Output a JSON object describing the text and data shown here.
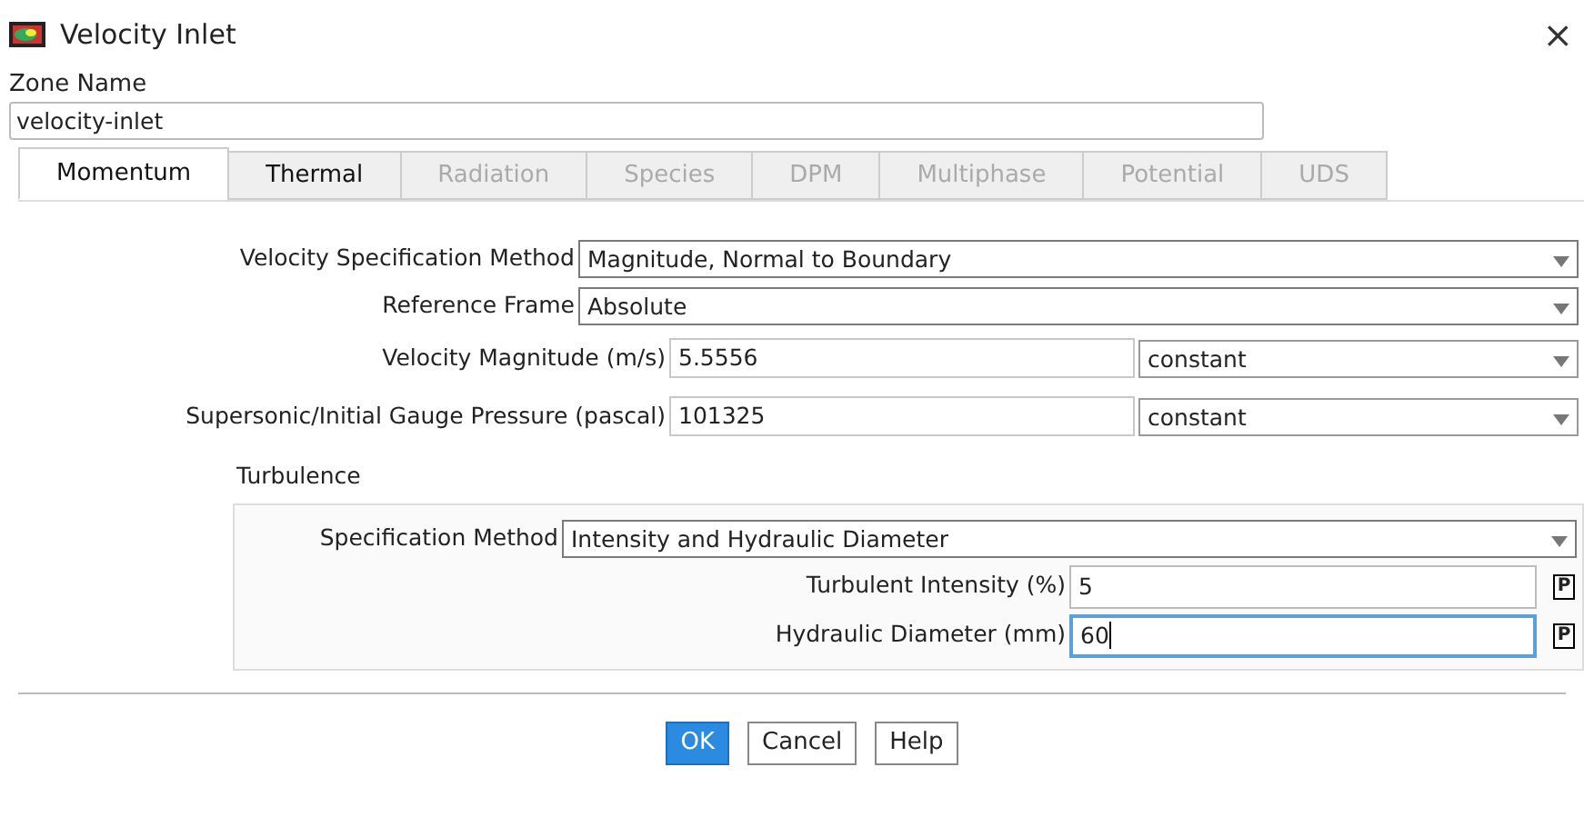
{
  "window": {
    "title": "Velocity Inlet",
    "close": "×"
  },
  "zone": {
    "label": "Zone Name",
    "value": "velocity-inlet"
  },
  "tabs": [
    {
      "label": "Momentum",
      "selected": true,
      "disabled": false
    },
    {
      "label": "Thermal",
      "selected": false,
      "disabled": false
    },
    {
      "label": "Radiation",
      "selected": false,
      "disabled": true
    },
    {
      "label": "Species",
      "selected": false,
      "disabled": true
    },
    {
      "label": "DPM",
      "selected": false,
      "disabled": true
    },
    {
      "label": "Multiphase",
      "selected": false,
      "disabled": true
    },
    {
      "label": "Potential",
      "selected": false,
      "disabled": true
    },
    {
      "label": "UDS",
      "selected": false,
      "disabled": true
    }
  ],
  "fields": [
    {
      "kind": "select",
      "label": "Velocity Specification Method",
      "value": "Magnitude, Normal to Boundary"
    },
    {
      "kind": "select",
      "label": "Reference Frame",
      "value": "Absolute"
    },
    {
      "kind": "value",
      "label": "Velocity Magnitude (m/s)",
      "value": "5.5556",
      "profile": "constant"
    },
    {
      "kind": "value",
      "label": "Supersonic/Initial Gauge Pressure (pascal)",
      "value": "101325",
      "profile": "constant"
    }
  ],
  "turbulence": {
    "title": "Turbulence",
    "fields": [
      {
        "kind": "select",
        "label": "Specification Method",
        "value": "Intensity and Hydraulic Diameter"
      },
      {
        "kind": "param",
        "label": "Turbulent Intensity (%)",
        "value": "5",
        "button": "P",
        "focused": false
      },
      {
        "kind": "param",
        "label": "Hydraulic Diameter (mm)",
        "value": "60",
        "button": "P",
        "focused": true
      }
    ]
  },
  "buttons": [
    {
      "label": "OK",
      "primary": true
    },
    {
      "label": "Cancel",
      "primary": false
    },
    {
      "label": "Help",
      "primary": false
    }
  ]
}
